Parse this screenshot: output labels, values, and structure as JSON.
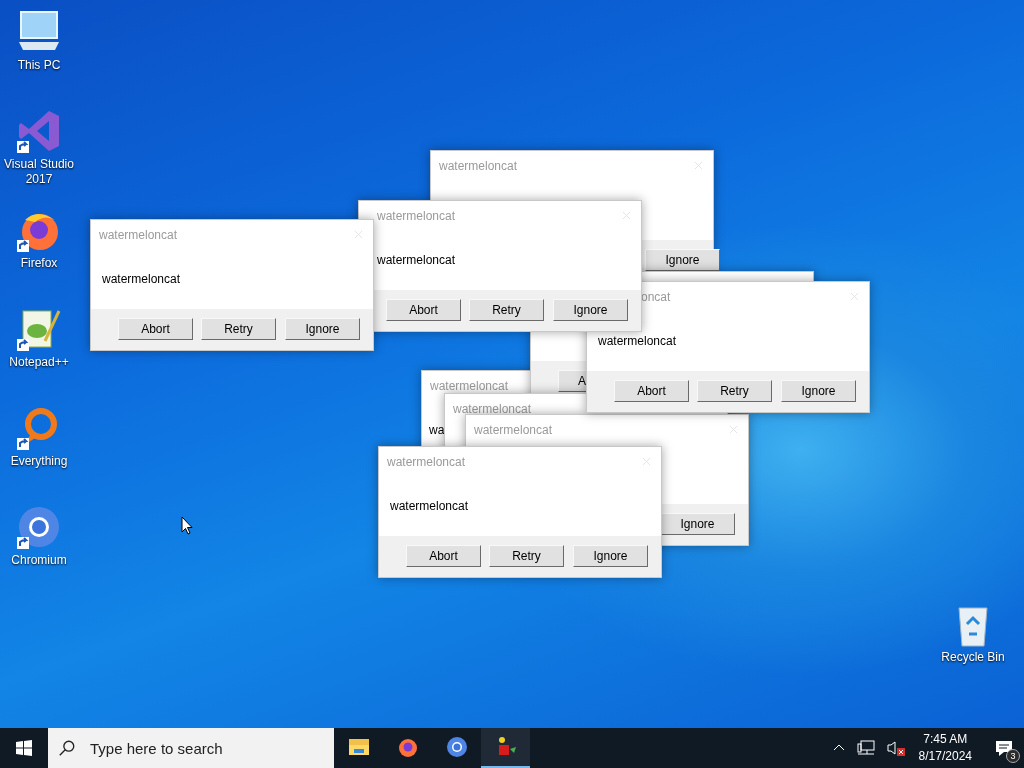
{
  "desktop_icons": [
    {
      "label": "This PC",
      "kind": "pc",
      "shortcut": false
    },
    {
      "label": "Visual Studio 2017",
      "kind": "vs",
      "shortcut": true
    },
    {
      "label": "Firefox",
      "kind": "firefox",
      "shortcut": true
    },
    {
      "label": "Notepad++",
      "kind": "notepad",
      "shortcut": true
    },
    {
      "label": "Everything",
      "kind": "everything",
      "shortcut": true
    },
    {
      "label": "Chromium",
      "kind": "chromium",
      "shortcut": true
    }
  ],
  "recycle_bin": {
    "label": "Recycle Bin"
  },
  "dialogs": [
    {
      "title": "watermeloncat",
      "buttons": [
        "Ignore"
      ]
    },
    {
      "title": "watermeloncat",
      "message": "wa"
    },
    {
      "buttons": [
        "A"
      ]
    },
    {
      "title": "oncat",
      "message": "watermeloncat",
      "buttons": [
        "Abort",
        "Retry",
        "Ignore"
      ]
    },
    {
      "title": "watermeloncat",
      "message": "watermeloncat",
      "buttons": [
        "Abort",
        "Retry",
        "Ignore"
      ]
    },
    {
      "title": "watermeloncat",
      "message": "watermeloncat",
      "buttons": [
        "Abort",
        "Retry",
        "Ignore"
      ]
    },
    {
      "title": "watermeloncat"
    },
    {
      "title": "watermeloncat",
      "buttons": [
        "Ignore"
      ]
    },
    {
      "title": "watermeloncat",
      "message": "watermeloncat",
      "buttons": [
        "Abort",
        "Retry",
        "Ignore"
      ]
    }
  ],
  "taskbar": {
    "search": {
      "placeholder": "Type here to search"
    },
    "pinned": [
      {
        "kind": "explorer",
        "active": false
      },
      {
        "kind": "firefox",
        "active": false
      },
      {
        "kind": "chromium",
        "active": false
      },
      {
        "kind": "app",
        "active": true
      }
    ],
    "tray": {
      "volume_muted": true,
      "time": "7:45 AM",
      "date": "8/17/2024",
      "notification_count": "3"
    }
  }
}
